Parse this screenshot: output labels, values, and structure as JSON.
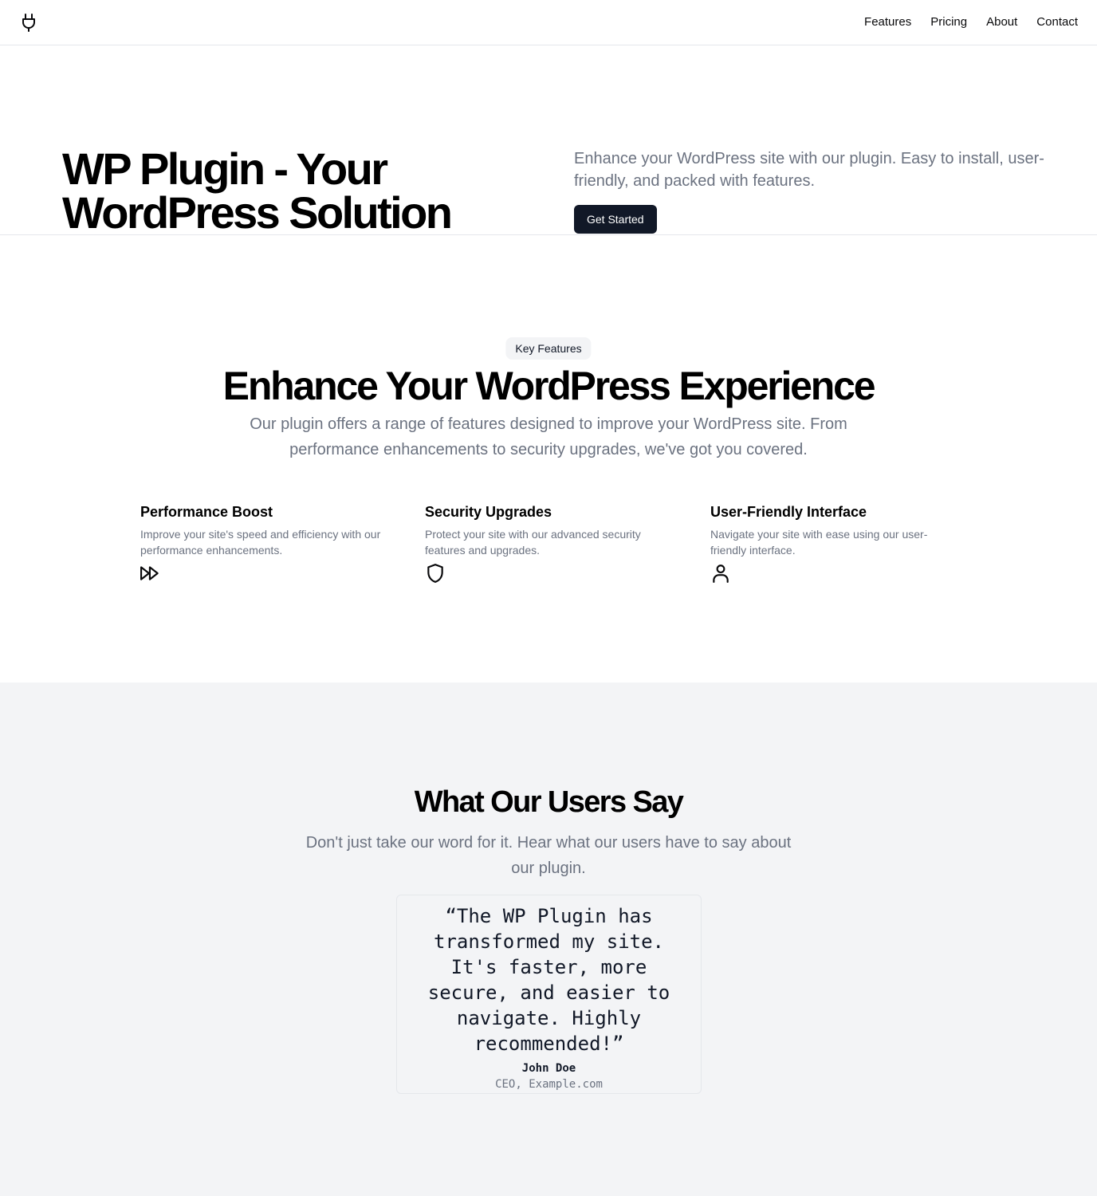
{
  "header": {
    "logo_icon": "plug-icon",
    "nav": [
      {
        "label": "Features"
      },
      {
        "label": "Pricing"
      },
      {
        "label": "About"
      },
      {
        "label": "Contact"
      }
    ]
  },
  "hero": {
    "title": "WP Plugin - Your WordPress Solution",
    "description": "Enhance your WordPress site with our plugin. Easy to install, user-friendly, and packed with features.",
    "cta_label": "Get Started"
  },
  "features": {
    "badge": "Key Features",
    "title": "Enhance Your WordPress Experience",
    "description": "Our plugin offers a range of features designed to improve your WordPress site. From performance enhancements to security upgrades, we've got you covered.",
    "items": [
      {
        "title": "Performance Boost",
        "description": "Improve your site's speed and efficiency with our performance enhancements.",
        "icon": "fast-forward-icon"
      },
      {
        "title": "Security Upgrades",
        "description": "Protect your site with our advanced security features and upgrades.",
        "icon": "shield-icon"
      },
      {
        "title": "User-Friendly Interface",
        "description": "Navigate your site with ease using our user-friendly interface.",
        "icon": "user-icon"
      }
    ]
  },
  "testimonials": {
    "title": "What Our Users Say",
    "description": "Don't just take our word for it. Hear what our users have to say about our plugin.",
    "items": [
      {
        "quote": "“The WP Plugin has transformed my site. It's faster, more secure, and easier to navigate. Highly recommended!”",
        "author": "John Doe",
        "role": "CEO, Example.com"
      }
    ]
  },
  "colors": {
    "primary_button": "#111827",
    "muted_text": "#6b7280",
    "section_bg": "#f3f4f6",
    "border": "#e5e7eb"
  }
}
